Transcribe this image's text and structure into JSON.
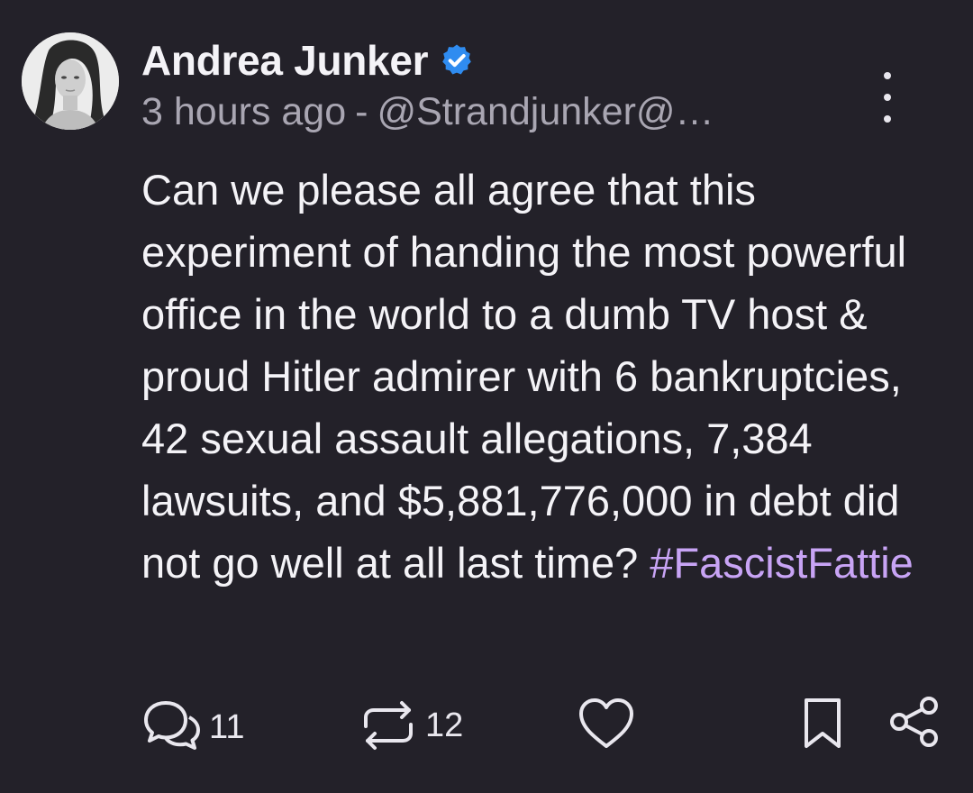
{
  "post": {
    "author": {
      "display_name": "Andrea Junker",
      "verified": true,
      "avatar": "profile-photo"
    },
    "meta": {
      "time": "3 hours ago",
      "separator": "-",
      "handle": "@Strandjunker@…"
    },
    "body": {
      "text": "Can we please all agree that this experiment of handing the most powerful office in the world to a dumb TV host & proud Hitler admirer with 6 bankruptcies, 42 sexual assault allegations, 7,384 lawsuits, and $5,881,776,000 in debt did not go well at all last time? ",
      "hashtag": "#FascistFattie"
    },
    "actions": {
      "replies": {
        "icon": "reply-icon",
        "count": "11"
      },
      "boosts": {
        "icon": "boost-icon",
        "count": "12"
      },
      "like": {
        "icon": "heart-icon"
      },
      "bookmark": {
        "icon": "bookmark-icon"
      },
      "share": {
        "icon": "share-icon"
      },
      "more": {
        "icon": "more-vertical-icon"
      }
    }
  },
  "colors": {
    "background": "#232129",
    "text": "#f4f3f7",
    "muted": "#a9a6b2",
    "hashtag": "#c8a4f5",
    "verified": "#2f8cf0"
  }
}
